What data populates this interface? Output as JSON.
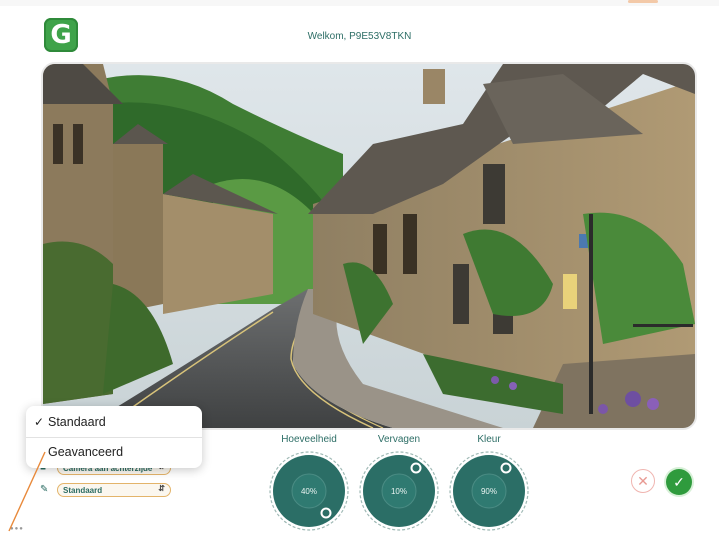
{
  "header": {
    "logo_letter": "G",
    "welcome_text": "Welkom, P9E53V8TKN"
  },
  "dropdown": {
    "options": [
      {
        "label": "Standaard",
        "checked": true,
        "check_mark": "✓"
      },
      {
        "label": "Geavanceerd",
        "checked": false,
        "check_mark": ""
      }
    ]
  },
  "settings": {
    "camera_select": {
      "value": "Camera aan achterzijde",
      "icon": "camera-icon"
    },
    "mode_select": {
      "value": "Standaard",
      "icon": "pen-icon"
    }
  },
  "knobs": [
    {
      "label": "Hoeveelheid",
      "value_text": "40%",
      "value": 0.4
    },
    {
      "label": "Vervagen",
      "value_text": "10%",
      "value": 0.1
    },
    {
      "label": "Kleur",
      "value_text": "90%",
      "value": 0.9
    }
  ],
  "actions": {
    "cancel_symbol": "✕",
    "confirm_symbol": "✓"
  },
  "footer": {
    "dots": "●●●"
  },
  "colors": {
    "accent": "#2a6b62",
    "knob_fill": "#2b6e66",
    "confirm": "#2f9b3d",
    "cancel": "#e89a93",
    "select_border": "#e3b46a"
  }
}
